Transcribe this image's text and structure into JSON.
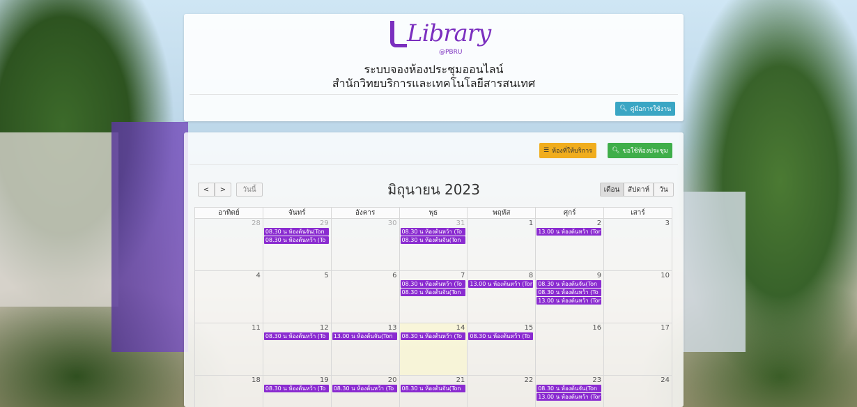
{
  "header": {
    "logo_text": "Library",
    "logo_sub": "@PBRU",
    "system_title": "ระบบจองห้องประชุมออนไลน์",
    "org_title": "สำนักวิทยบริการและเทคโนโลยีสารสนเทศ",
    "manual_button": "คู่มือการใช้งาน"
  },
  "toolbar": {
    "rooms_button": "ห้องที่ให้บริการ",
    "request_button": "ขอใช้ห้องประชุม",
    "prev": "<",
    "next": ">",
    "today": "วันนี้",
    "month_title": "มิถุนายน 2023",
    "views": [
      "เดือน",
      "สัปดาห์",
      "วัน"
    ],
    "active_view": "เดือน"
  },
  "calendar": {
    "weekdays": [
      "อาทิตย์",
      "จันทร์",
      "อังคาร",
      "พุธ",
      "พฤหัส",
      "ศุกร์",
      "เสาร์"
    ],
    "weeks": [
      [
        {
          "day": "28",
          "other": true,
          "events": []
        },
        {
          "day": "29",
          "other": true,
          "events": [
            "08.30 น ห้องต้นจัน(Ton",
            "08.30 น ห้องต้นหว้า (To"
          ]
        },
        {
          "day": "30",
          "other": true,
          "events": []
        },
        {
          "day": "31",
          "other": true,
          "events": [
            "08.30 น ห้องต้นหว้า (To",
            "08.30 น ห้องต้นจัน(Ton"
          ]
        },
        {
          "day": "1",
          "other": false,
          "events": []
        },
        {
          "day": "2",
          "other": false,
          "events": [
            "13.00 น ห้องต้นหว้า (Tor"
          ]
        },
        {
          "day": "3",
          "other": false,
          "events": []
        }
      ],
      [
        {
          "day": "4",
          "other": false,
          "events": []
        },
        {
          "day": "5",
          "other": false,
          "events": []
        },
        {
          "day": "6",
          "other": false,
          "events": []
        },
        {
          "day": "7",
          "other": false,
          "events": [
            "08.30 น ห้องต้นหว้า (To",
            "08.30 น ห้องต้นจัน(Ton"
          ]
        },
        {
          "day": "8",
          "other": false,
          "events": [
            "13.00 น ห้องต้นหว้า (Tor"
          ]
        },
        {
          "day": "9",
          "other": false,
          "events": [
            "08.30 น ห้องต้นจัน(Ton",
            "08.30 น ห้องต้นหว้า (To",
            "13.00 น ห้องต้นหว้า (Tor"
          ]
        },
        {
          "day": "10",
          "other": false,
          "events": []
        }
      ],
      [
        {
          "day": "11",
          "other": false,
          "events": []
        },
        {
          "day": "12",
          "other": false,
          "events": [
            "08.30 น ห้องต้นหว้า (To"
          ]
        },
        {
          "day": "13",
          "other": false,
          "events": [
            "13.00 น ห้องต้นจัน(Ton"
          ]
        },
        {
          "day": "14",
          "other": false,
          "today": true,
          "events": [
            "08.30 น ห้องต้นหว้า (To"
          ]
        },
        {
          "day": "15",
          "other": false,
          "events": [
            "08.30 น ห้องต้นหว้า (To"
          ]
        },
        {
          "day": "16",
          "other": false,
          "events": []
        },
        {
          "day": "17",
          "other": false,
          "events": []
        }
      ],
      [
        {
          "day": "18",
          "other": false,
          "events": []
        },
        {
          "day": "19",
          "other": false,
          "events": [
            "08.30 น ห้องต้นหว้า (To"
          ]
        },
        {
          "day": "20",
          "other": false,
          "events": [
            "08.30 น ห้องต้นหว้า (To"
          ]
        },
        {
          "day": "21",
          "other": false,
          "events": [
            "08.30 น ห้องต้นจัน(Ton"
          ]
        },
        {
          "day": "22",
          "other": false,
          "events": []
        },
        {
          "day": "23",
          "other": false,
          "events": [
            "08.30 น ห้องต้นจัน(Ton",
            "13.00 น ห้องต้นหว้า (Tor"
          ]
        },
        {
          "day": "24",
          "other": false,
          "events": []
        }
      ]
    ]
  }
}
